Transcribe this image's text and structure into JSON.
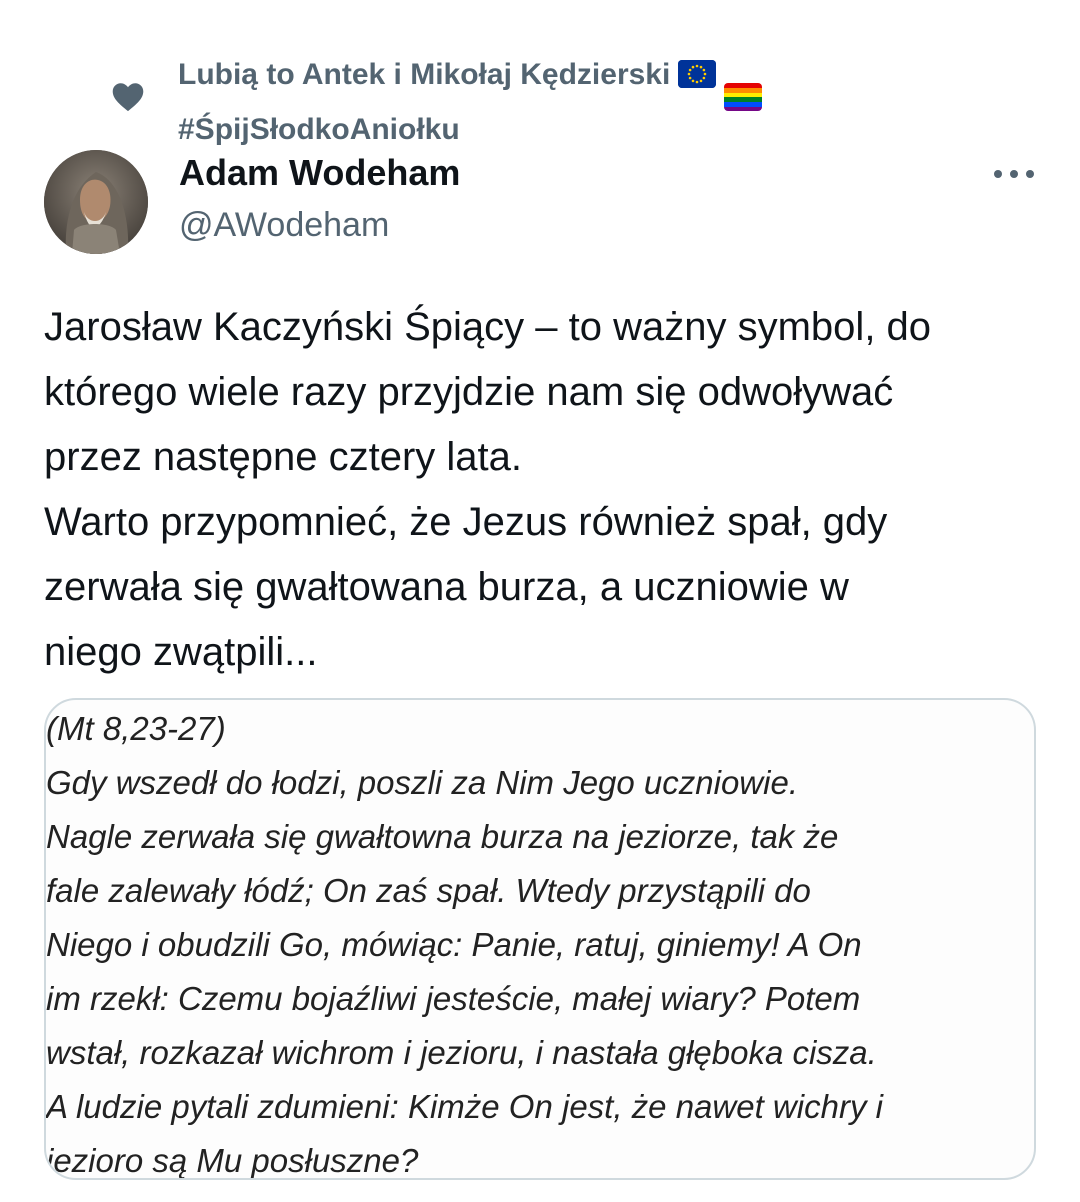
{
  "social_context": {
    "text": "Lubią to Antek i Mikołaj Kędzierski",
    "hashtag": "#ŚpijSłodkoAniołku",
    "icon": "heart-icon",
    "flags": [
      "eu-flag",
      "rainbow-flag"
    ]
  },
  "author": {
    "name": "Adam Wodeham",
    "handle": "@AWodeham",
    "avatar": "avatar"
  },
  "tweet": {
    "lines": [
      "Jarosław Kaczyński Śpiący – to ważny symbol, do",
      "którego wiele razy przyjdzie nam się odwoływać",
      "przez następne cztery lata.",
      "Warto przypomnieć, że Jezus również spał, gdy",
      "zerwała się gwałtowana burza, a uczniowie w",
      "niego zwątpili..."
    ]
  },
  "media": {
    "lines": [
      "(Mt 8,23-27)",
      "Gdy wszedł do łodzi, poszli za Nim Jego uczniowie.",
      "Nagle zerwała się gwałtowna burza na jeziorze, tak że",
      "fale zalewały łódź; On zaś spał. Wtedy przystąpili do",
      "Niego i obudzili Go, mówiąc: Panie, ratuj, giniemy! A On",
      "im rzekł: Czemu bojaźliwi jesteście, małej wiary? Potem",
      "wstał, rozkazał wichrom i jezioru, i nastała głęboka cisza.",
      "A ludzie pytali zdumieni: Kimże On jest, że nawet wichry i",
      "jezioro są Mu posłuszne?"
    ]
  },
  "colors": {
    "text": "#0f1419",
    "secondary": "#536471",
    "border": "#cfd9de"
  }
}
